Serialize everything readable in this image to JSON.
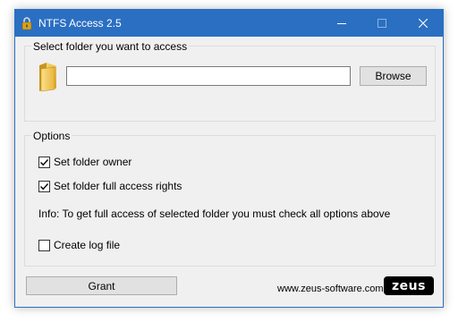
{
  "window": {
    "title": "NTFS Access 2.5",
    "app_icon": "padlock-icon",
    "titlebar_color": "#2b6fc2",
    "controls": {
      "minimize_icon": "minimize-icon",
      "maximize_icon": "maximize-icon",
      "close_icon": "close-icon"
    }
  },
  "folder_group": {
    "legend": "Select folder you want to access",
    "folder_icon": "folder-icon",
    "path_value": "",
    "browse_label": "Browse"
  },
  "options_group": {
    "legend": "Options",
    "options": [
      {
        "label": "Set folder owner",
        "checked": true
      },
      {
        "label": "Set folder full access rights",
        "checked": true
      }
    ],
    "info": "Info: To get full access of selected folder you must check all options above",
    "log": {
      "label": "Create log file",
      "checked": false
    }
  },
  "footer": {
    "grant_label": "Grant",
    "website": "www.zeus-software.com",
    "logo": "zeus"
  }
}
